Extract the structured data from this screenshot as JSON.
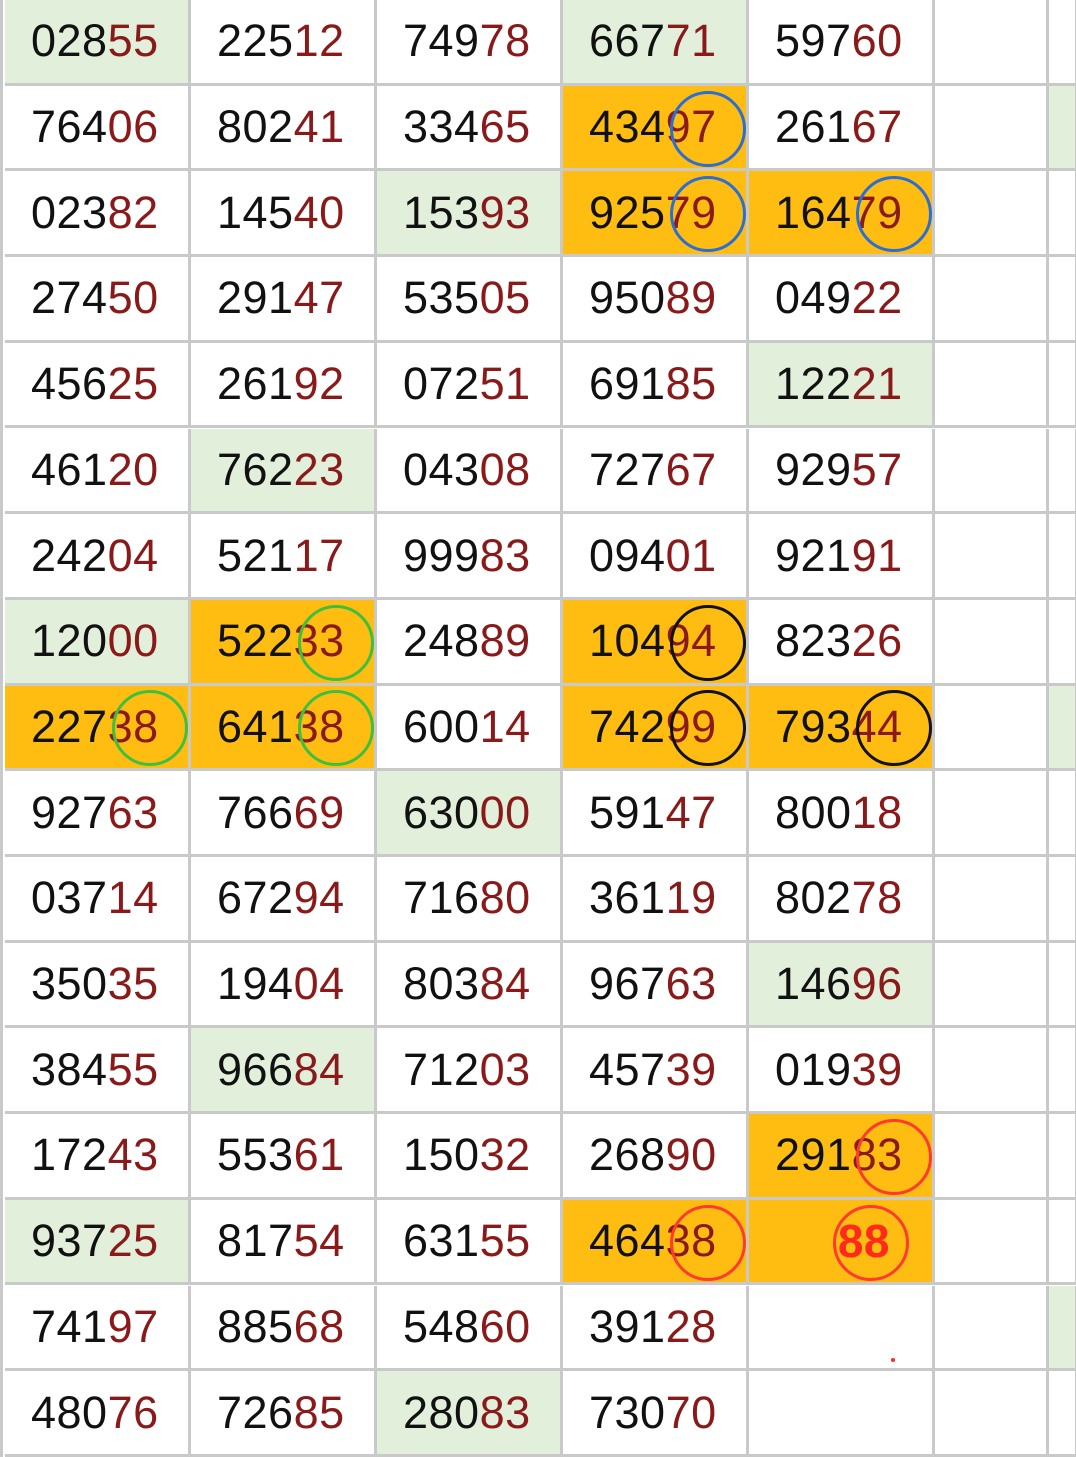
{
  "rows": [
    [
      "02855",
      "22512",
      "74978",
      "66771",
      "59760"
    ],
    [
      "76406",
      "80241",
      "33465",
      "43497",
      "26167"
    ],
    [
      "02382",
      "14540",
      "15393",
      "92579",
      "16479"
    ],
    [
      "27450",
      "29147",
      "53505",
      "95089",
      "04922"
    ],
    [
      "45625",
      "26192",
      "07251",
      "69185",
      "12221"
    ],
    [
      "46120",
      "76223",
      "04308",
      "72767",
      "92957"
    ],
    [
      "24204",
      "52117",
      "99983",
      "09401",
      "92191"
    ],
    [
      "12000",
      "52233",
      "24889",
      "10494",
      "82326"
    ],
    [
      "22738",
      "64138",
      "60014",
      "74299",
      "79344"
    ],
    [
      "92763",
      "76669",
      "63000",
      "59147",
      "80018"
    ],
    [
      "03714",
      "67294",
      "71680",
      "36119",
      "80278"
    ],
    [
      "35035",
      "19404",
      "80384",
      "96763",
      "14696"
    ],
    [
      "38455",
      "96684",
      "71203",
      "45739",
      "01939"
    ],
    [
      "17243",
      "55361",
      "15032",
      "26890",
      "29183"
    ],
    [
      "93725",
      "81754",
      "63155",
      "46438",
      "88"
    ],
    [
      "74197",
      "88568",
      "54860",
      "39128",
      ""
    ],
    [
      "48076",
      "72685",
      "28083",
      "73070",
      ""
    ]
  ],
  "highlights": {
    "green": [
      [
        0,
        0
      ],
      [
        0,
        3
      ],
      [
        2,
        2
      ],
      [
        4,
        4
      ],
      [
        5,
        1
      ],
      [
        7,
        0
      ],
      [
        9,
        2
      ],
      [
        11,
        4
      ],
      [
        12,
        1
      ],
      [
        14,
        0
      ],
      [
        16,
        2
      ],
      [
        1,
        6
      ],
      [
        8,
        6
      ],
      [
        15,
        6
      ]
    ],
    "orange": [
      [
        1,
        3
      ],
      [
        2,
        3
      ],
      [
        2,
        4
      ],
      [
        7,
        1
      ],
      [
        7,
        3
      ],
      [
        8,
        0
      ],
      [
        8,
        1
      ],
      [
        8,
        3
      ],
      [
        8,
        4
      ],
      [
        13,
        4
      ],
      [
        14,
        3
      ],
      [
        14,
        4
      ]
    ]
  },
  "circles": [
    {
      "row": 1,
      "col": 3,
      "color": "#2b6fd6"
    },
    {
      "row": 2,
      "col": 3,
      "color": "#2b6fd6"
    },
    {
      "row": 2,
      "col": 4,
      "color": "#2b6fd6"
    },
    {
      "row": 7,
      "col": 1,
      "color": "#3fbf3f"
    },
    {
      "row": 8,
      "col": 0,
      "color": "#3fbf3f"
    },
    {
      "row": 8,
      "col": 1,
      "color": "#3fbf3f"
    },
    {
      "row": 7,
      "col": 3,
      "color": "#111111"
    },
    {
      "row": 8,
      "col": 3,
      "color": "#111111"
    },
    {
      "row": 8,
      "col": 4,
      "color": "#111111"
    },
    {
      "row": 13,
      "col": 4,
      "color": "#ff3b30"
    },
    {
      "row": 14,
      "col": 3,
      "color": "#ff3b30"
    },
    {
      "row": 14,
      "col": 4,
      "color": "#ff3b30"
    }
  ],
  "colors": {
    "head": "#111111",
    "tail": "#8a1a1a",
    "green": "#e1efdb",
    "orange": "#ffbd11"
  }
}
